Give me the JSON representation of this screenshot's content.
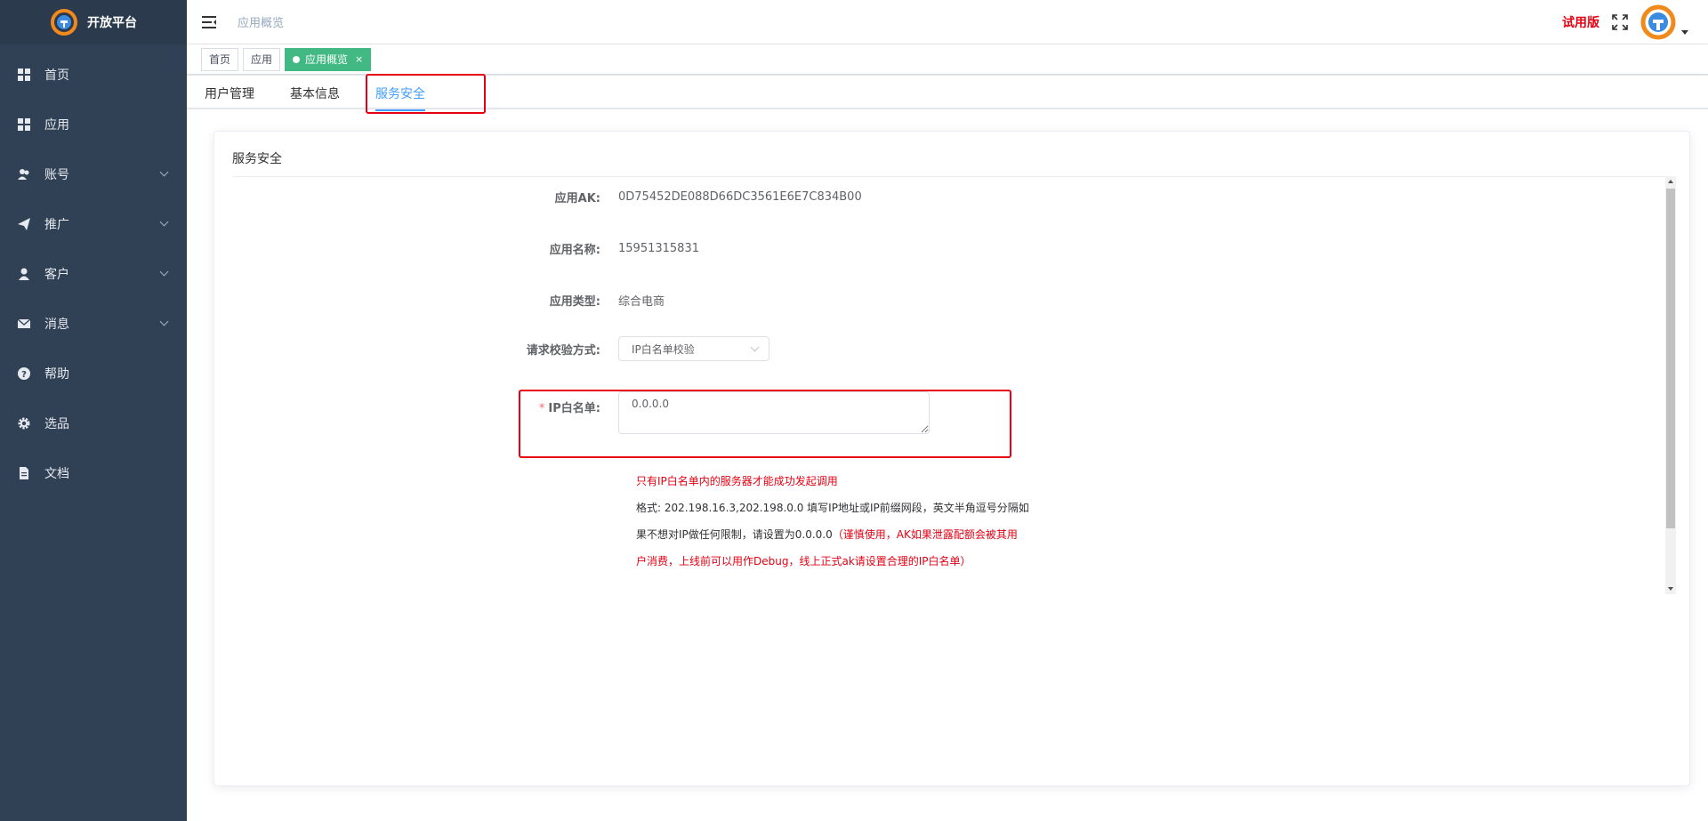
{
  "brand": {
    "name": "开放平台"
  },
  "sidebar": {
    "items": [
      {
        "label": "首页",
        "icon": "dashboard-icon",
        "expandable": false
      },
      {
        "label": "应用",
        "icon": "grid-icon",
        "expandable": false
      },
      {
        "label": "账号",
        "icon": "users-icon",
        "expandable": true
      },
      {
        "label": "推广",
        "icon": "paper-plane-icon",
        "expandable": true
      },
      {
        "label": "客户",
        "icon": "user-icon",
        "expandable": true
      },
      {
        "label": "消息",
        "icon": "envelope-icon",
        "expandable": true
      },
      {
        "label": "帮助",
        "icon": "question-icon",
        "expandable": false
      },
      {
        "label": "选品",
        "icon": "gear-icon",
        "expandable": false
      },
      {
        "label": "文档",
        "icon": "document-icon",
        "expandable": false
      }
    ]
  },
  "navbar": {
    "breadcrumb": "应用概览",
    "trial_label": "试用版"
  },
  "tags": {
    "items": [
      "首页",
      "应用"
    ],
    "active": "应用概览",
    "close": "×"
  },
  "subtabs": [
    "用户管理",
    "基本信息",
    "服务安全"
  ],
  "card": {
    "title": "服务安全",
    "fields": {
      "ak_label": "应用AK:",
      "ak_value": "0D75452DE088D66DC3561E6E7C834B00",
      "name_label": "应用名称:",
      "name_value": "15951315831",
      "type_label": "应用类型:",
      "type_value": "综合电商",
      "verify_label": "请求校验方式:",
      "verify_value": "IP白名单校验",
      "ip_required": "*",
      "ip_label": "IP白名单:",
      "ip_value": "0.0.0.0"
    },
    "help": {
      "line1": "只有IP白名单内的服务器才能成功发起调用",
      "line2": "格式: 202.198.16.3,202.198.0.0 填写IP地址或IP前缀网段，英文半角逗号分隔如",
      "line3_black": "果不想对IP做任何限制，请设置为0.0.0.0",
      "line3_red": "（谨慎使用，AK如果泄露配额会被其用",
      "line4": "户消费，上线前可以用作Debug，线上正式ak请设置合理的IP白名单）"
    }
  },
  "colors": {
    "sidebar_bg": "#304156",
    "accent": "#409eff",
    "active_tag": "#42b983",
    "alert_red": "#e60012"
  }
}
